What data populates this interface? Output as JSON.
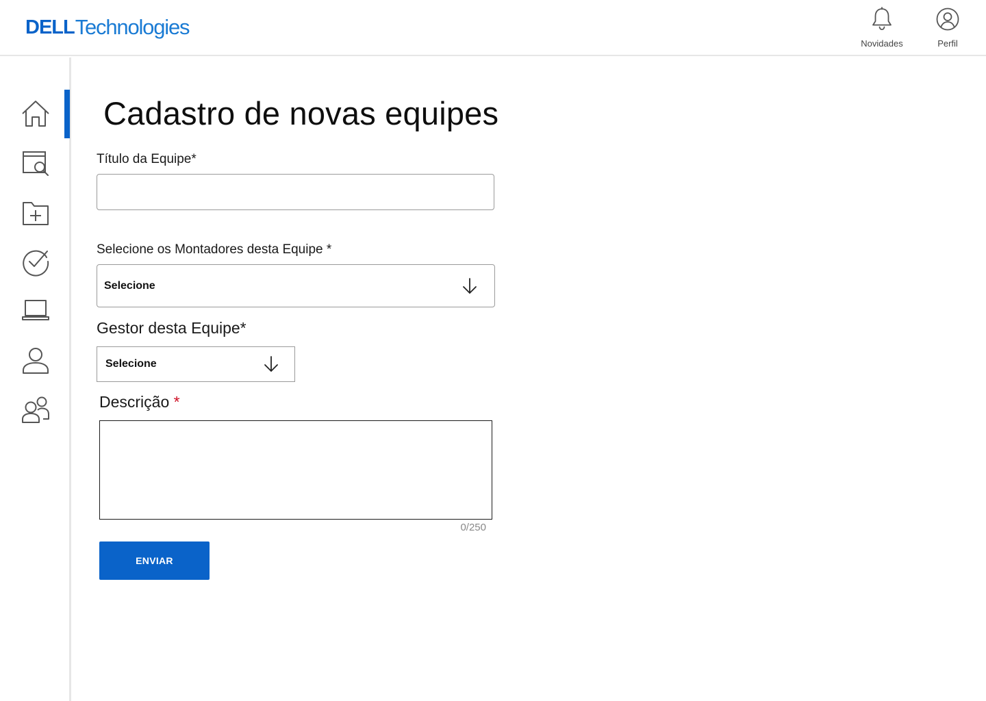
{
  "header": {
    "logo_dell": "DELL",
    "logo_technologies": "Technologies",
    "news_label": "Novidades",
    "profile_label": "Perfil"
  },
  "sidebar": {
    "items": [
      {
        "icon": "home-icon",
        "active": true
      },
      {
        "icon": "search-document-icon",
        "active": false
      },
      {
        "icon": "folder-add-icon",
        "active": false
      },
      {
        "icon": "check-circle-icon",
        "active": false
      },
      {
        "icon": "laptop-icon",
        "active": false
      },
      {
        "icon": "user-icon",
        "active": false
      },
      {
        "icon": "users-group-icon",
        "active": false
      }
    ]
  },
  "main": {
    "title": "Cadastro de novas equipes",
    "team_title_label": "Título da Equipe*",
    "team_title_value": "",
    "assemblers_label": "Selecione os Montadores desta Equipe *",
    "assemblers_value": "Selecione",
    "manager_label": "Gestor desta Equipe*",
    "manager_value": "Selecione",
    "description_label": "Descrição",
    "description_required": "*",
    "description_value": "",
    "counter": "0/250",
    "submit_label": "ENVIAR"
  },
  "colors": {
    "accent": "#0a63c9",
    "required": "#ce1126",
    "icon_gray": "#555555"
  }
}
